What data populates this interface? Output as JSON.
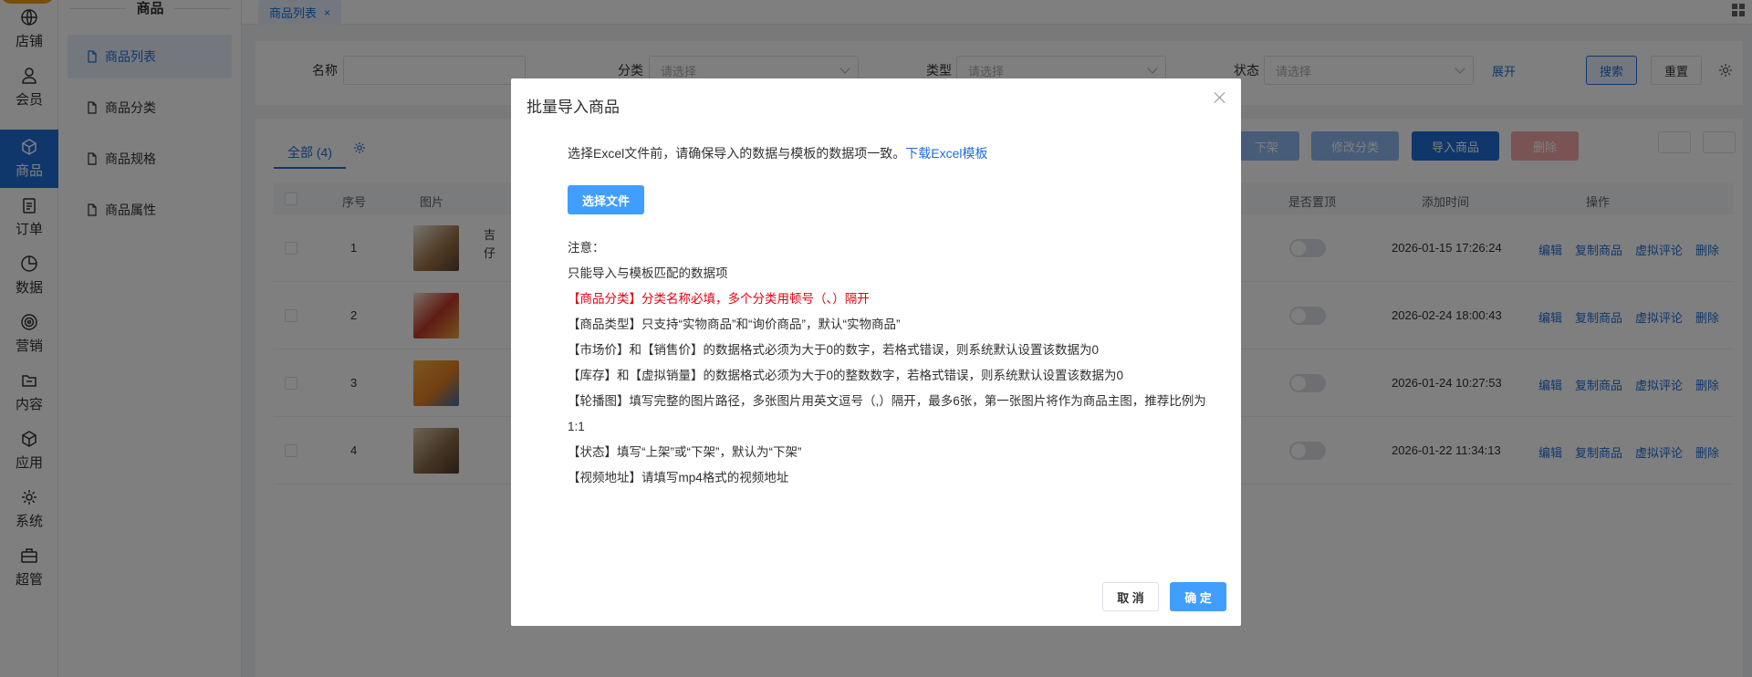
{
  "rail": {
    "items": [
      {
        "label": "店铺",
        "icon": "store-icon"
      },
      {
        "label": "会员",
        "icon": "user-icon"
      },
      {
        "label": "商品",
        "icon": "cube-icon",
        "active": true
      },
      {
        "label": "订单",
        "icon": "clipboard-icon"
      },
      {
        "label": "数据",
        "icon": "pie-chart-icon"
      },
      {
        "label": "营销",
        "icon": "target-icon"
      },
      {
        "label": "内容",
        "icon": "folder-icon"
      },
      {
        "label": "应用",
        "icon": "box-icon"
      },
      {
        "label": "系统",
        "icon": "gear-icon"
      },
      {
        "label": "超管",
        "icon": "briefcase-icon"
      }
    ]
  },
  "submenu": {
    "title": "商品",
    "items": [
      {
        "label": "商品列表",
        "active": true
      },
      {
        "label": "商品分类"
      },
      {
        "label": "商品规格"
      },
      {
        "label": "商品属性"
      }
    ]
  },
  "tabbar": {
    "tab_label": "商品列表",
    "tab_close": "×"
  },
  "filter": {
    "name_label": "名称",
    "category_label": "分类",
    "category_placeholder": "请选择",
    "type_label": "类型",
    "type_placeholder": "请选择",
    "status_label": "状态",
    "status_placeholder": "请选择",
    "expand_label": "展开",
    "search_label": "搜索",
    "reset_label": "重置"
  },
  "list": {
    "tab_all": "全部",
    "tab_count": "(4)",
    "actions": {
      "off_shelf": "下架",
      "edit_category": "修改分类",
      "import": "导入商品",
      "delete": "删除"
    },
    "columns": {
      "index": "序号",
      "image": "图片",
      "pinned": "是否置顶",
      "added_time": "添加时间",
      "operation": "操作"
    },
    "name_partial_1": "吉",
    "name_partial_2": "仔",
    "rows": [
      {
        "index": "1",
        "time": "2026-01-15 17:26:24"
      },
      {
        "index": "2",
        "time": "2026-02-24 18:00:43"
      },
      {
        "index": "3",
        "time": "2026-01-24 10:27:53"
      },
      {
        "index": "4",
        "time": "2026-01-22 11:34:13"
      }
    ],
    "ops": {
      "edit": "编辑",
      "copy": "复制商品",
      "review": "虚拟评论",
      "delete": "删除"
    }
  },
  "modal": {
    "title": "批量导入商品",
    "intro": "选择Excel文件前，请确保导入的数据与模板的数据项一致。",
    "download_link": "下载Excel模板",
    "choose_file": "选择文件",
    "notes": [
      "注意：",
      "只能导入与模板匹配的数据项",
      "【商品分类】分类名称必填，多个分类用顿号（、）隔开",
      "【商品类型】只支持“实物商品”和“询价商品”，默认“实物商品”",
      "【市场价】和【销售价】的数据格式必须为大于0的数字，若格式错误，则系统默认设置该数据为0",
      "【库存】和【虚拟销量】的数据格式必须为大于0的整数数字，若格式错误，则系统默认设置该数据为0",
      "【轮播图】填写完整的图片路径，多张图片用英文逗号（,）隔开，最多6张，第一张图片将作为商品主图，推荐比例为1:1",
      "【状态】填写“上架”或“下架”，默认为“下架”",
      "【视频地址】请填写mp4格式的视频地址"
    ],
    "cancel": "取 消",
    "confirm": "确 定"
  },
  "colors": {
    "primary": "#1e6fd9",
    "button_blue": "#409eff",
    "warning_red": "#e60012"
  }
}
